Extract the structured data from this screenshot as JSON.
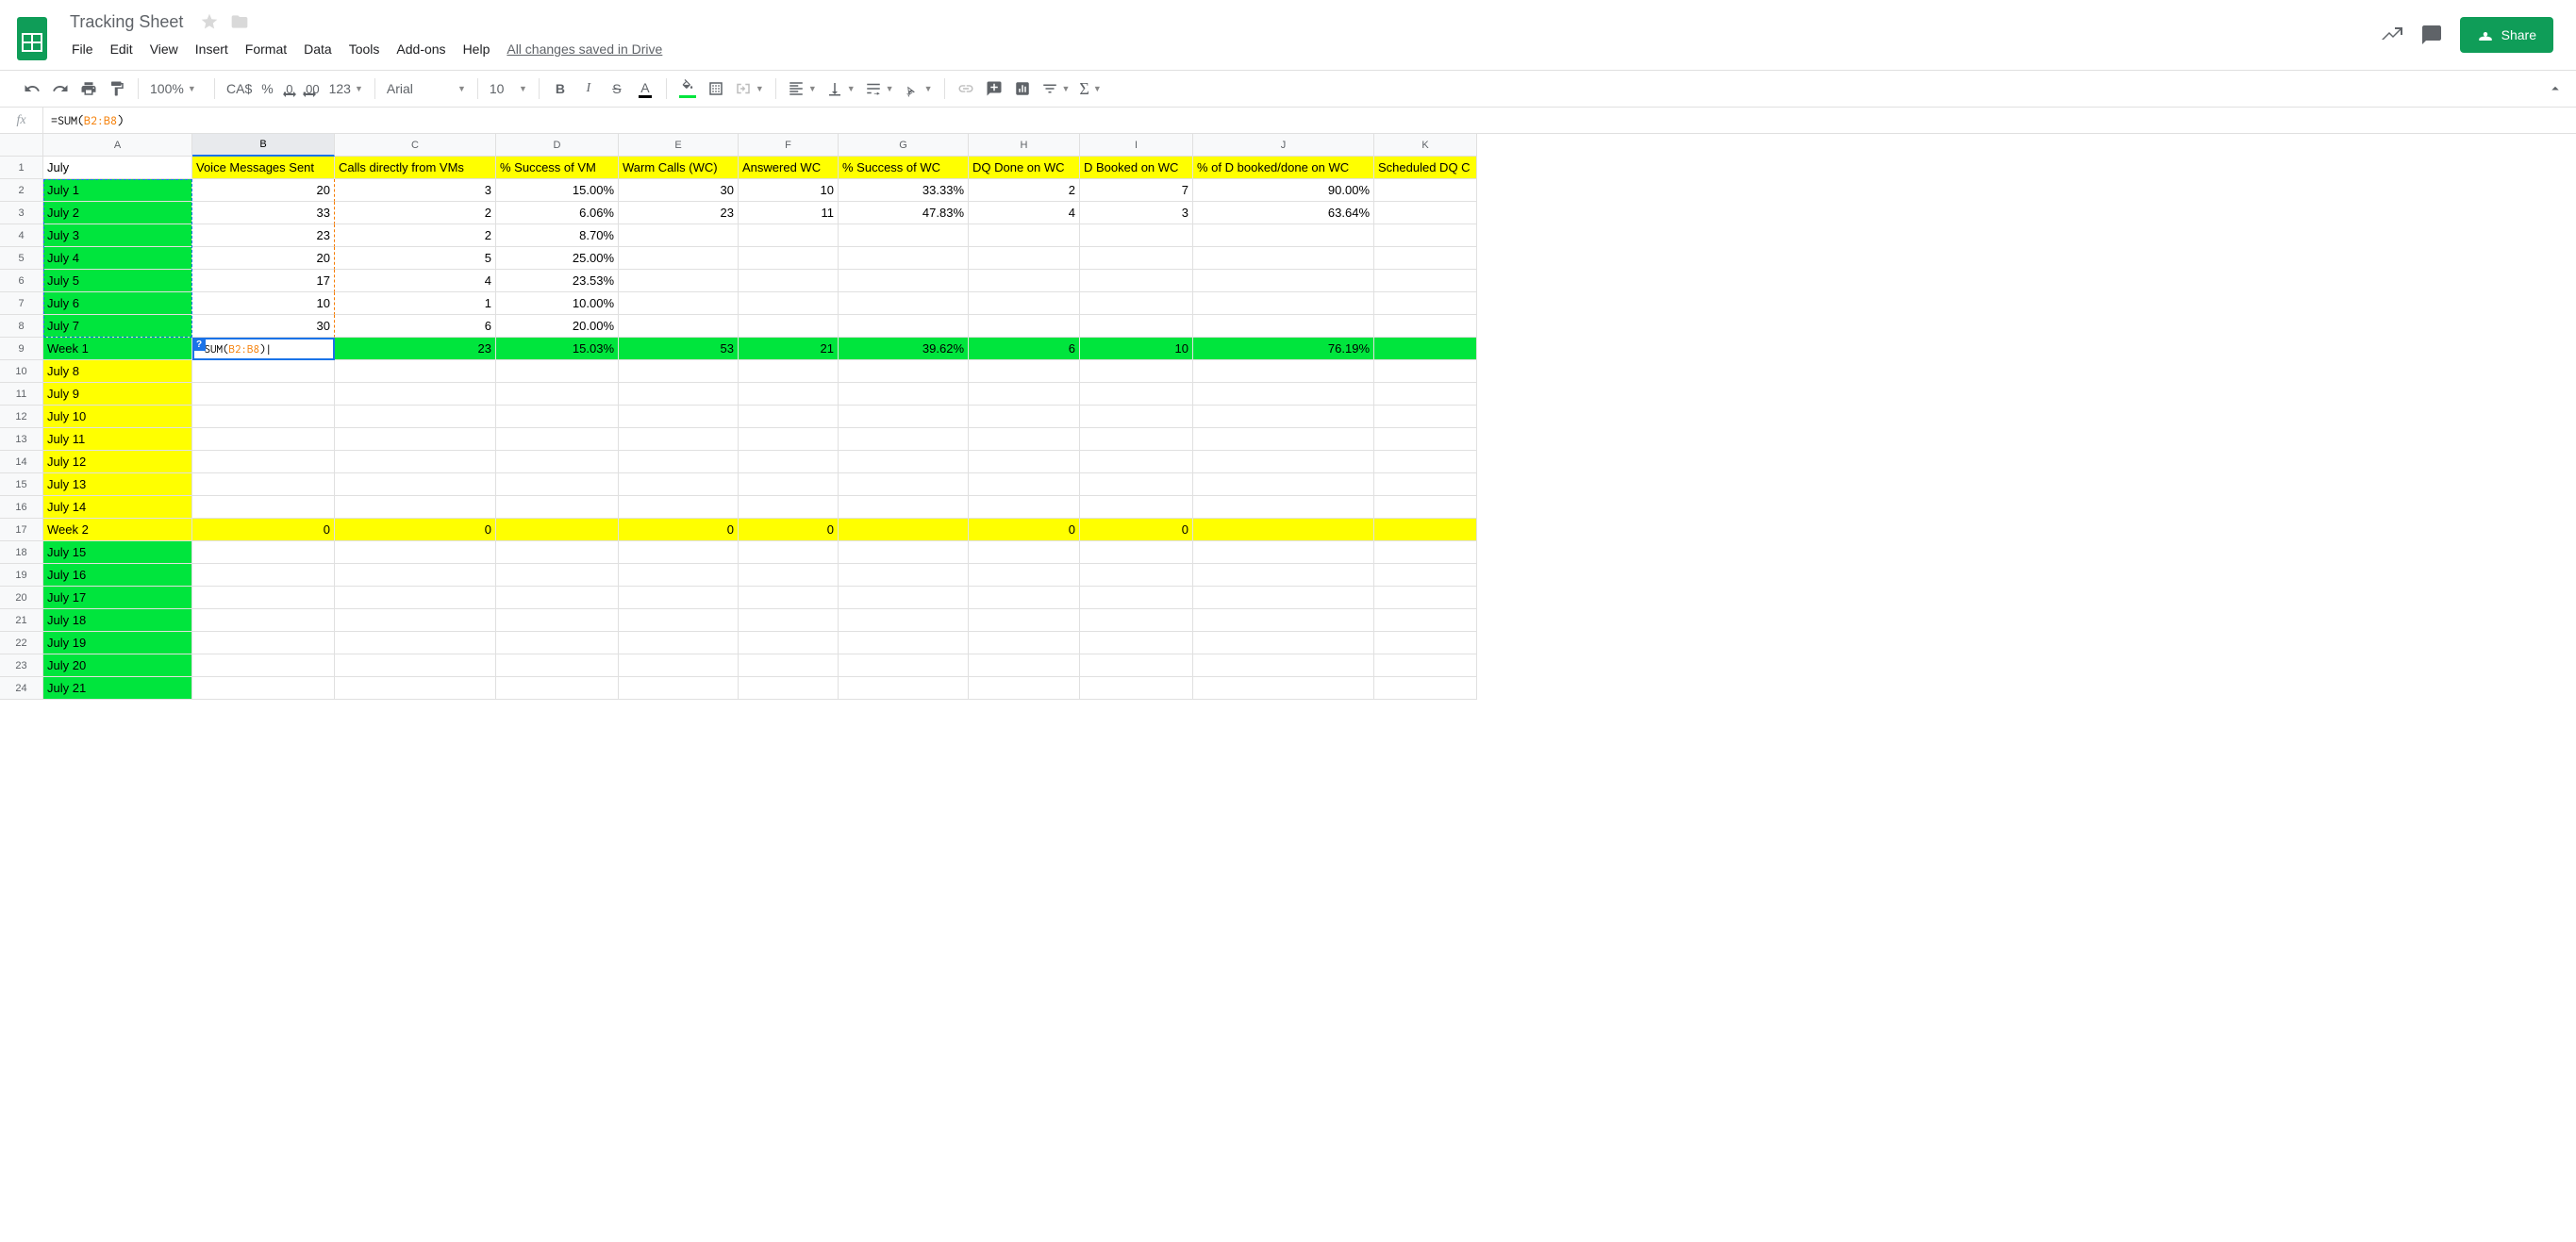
{
  "doc": {
    "title": "Tracking Sheet",
    "drive_status": "All changes saved in Drive"
  },
  "menu": [
    "File",
    "Edit",
    "View",
    "Insert",
    "Format",
    "Data",
    "Tools",
    "Add-ons",
    "Help"
  ],
  "share_label": "Share",
  "toolbar": {
    "zoom": "100%",
    "currency": "CA$",
    "percent": "%",
    "dec_less": ".0",
    "dec_more": ".00",
    "num_fmt": "123",
    "font": "Arial",
    "size": "10"
  },
  "formula": {
    "prefix": "=SUM(",
    "range": "B2:B8",
    "suffix": ")"
  },
  "cols": [
    "A",
    "B",
    "C",
    "D",
    "E",
    "F",
    "G",
    "H",
    "I",
    "J",
    "K"
  ],
  "selected_col": "B",
  "rows": {
    "count": 24,
    "row1": {
      "A": "July",
      "B": "Voice Messages Sent",
      "C": "Calls directly from VMs",
      "D": "% Success of VM",
      "E": "Warm Calls (WC)",
      "F": "Answered WC",
      "G": "% Success of WC",
      "H": "DQ Done on WC",
      "I": "D Booked on WC",
      "J": "% of D booked/done on WC",
      "K": "Scheduled DQ C"
    },
    "data": [
      {
        "A": "July 1",
        "B": "20",
        "C": "3",
        "D": "15.00%",
        "E": "30",
        "F": "10",
        "G": "33.33%",
        "H": "2",
        "I": "7",
        "J": "90.00%"
      },
      {
        "A": "July 2",
        "B": "33",
        "C": "2",
        "D": "6.06%",
        "E": "23",
        "F": "11",
        "G": "47.83%",
        "H": "4",
        "I": "3",
        "J": "63.64%"
      },
      {
        "A": "July 3",
        "B": "23",
        "C": "2",
        "D": "8.70%"
      },
      {
        "A": "July 4",
        "B": "20",
        "C": "5",
        "D": "25.00%"
      },
      {
        "A": "July 5",
        "B": "17",
        "C": "4",
        "D": "23.53%"
      },
      {
        "A": "July 6",
        "B": "10",
        "C": "1",
        "D": "10.00%"
      },
      {
        "A": "July 7",
        "B": "30",
        "C": "6",
        "D": "20.00%"
      }
    ],
    "week1": {
      "A": "Week 1",
      "C": "23",
      "D": "15.03%",
      "E": "53",
      "F": "21",
      "G": "39.62%",
      "H": "6",
      "I": "10",
      "J": "76.19%"
    },
    "block2_days": [
      "July 8",
      "July 9",
      "July 10",
      "July 11",
      "July 12",
      "July 13",
      "July 14"
    ],
    "week2": {
      "A": "Week 2",
      "B": "0",
      "C": "0",
      "E": "0",
      "F": "0",
      "H": "0",
      "I": "0"
    },
    "block3_days": [
      "July 15",
      "July 16",
      "July 17",
      "July 18",
      "July 19",
      "July 20",
      "July 21"
    ]
  },
  "editing": {
    "hint": "?",
    "prefix": "=SUM(",
    "range": "B2:B8",
    "suffix": ")"
  }
}
